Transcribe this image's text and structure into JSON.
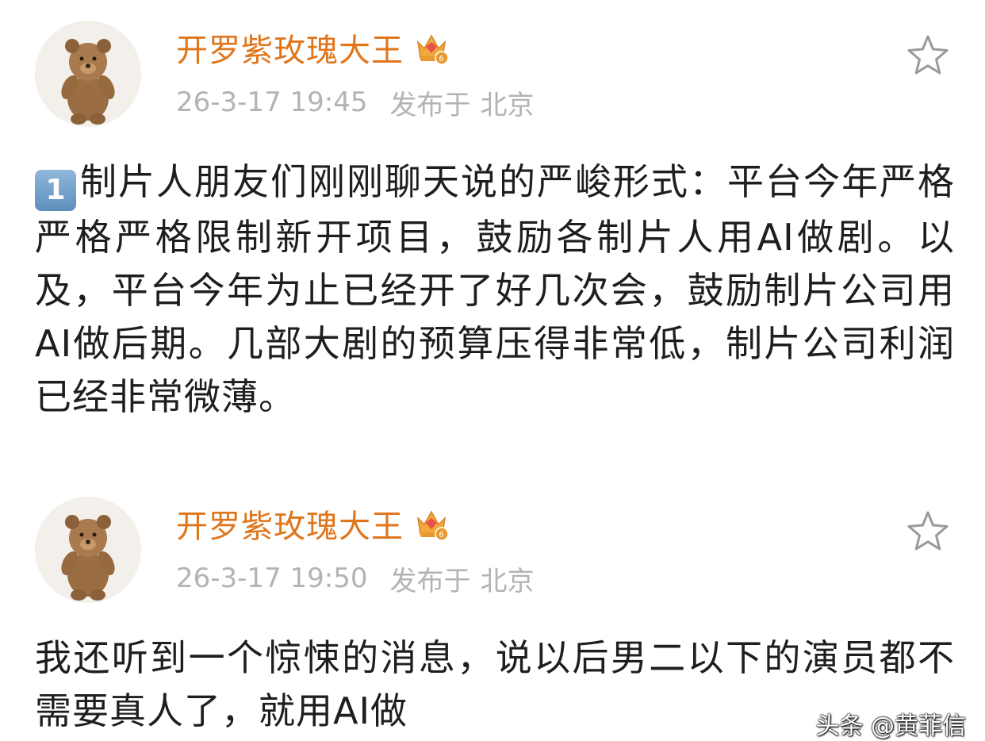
{
  "posts": [
    {
      "username": "开罗紫玫瑰大王",
      "vip_level": "6",
      "time": "26-3-17 19:45",
      "location_label": "发布于",
      "location": "北京",
      "number_badge": "1",
      "content": "制片人朋友们刚刚聊天说的严峻形式：平台今年严格严格严格限制新开项目，鼓励各制片人用AI做剧。以及，平台今年为止已经开了好几次会，鼓励制片公司用AI做后期。几部大剧的预算压得非常低，制片公司利润已经非常微薄。",
      "icons": {
        "avatar": "teddy-bear-avatar",
        "badge": "crown-vip-icon",
        "favorite": "star-icon"
      }
    },
    {
      "username": "开罗紫玫瑰大王",
      "vip_level": "6",
      "time": "26-3-17 19:50",
      "location_label": "发布于",
      "location": "北京",
      "content": "我还听到一个惊悚的消息，说以后男二以下的演员都不需要真人了，就用AI做",
      "icons": {
        "avatar": "teddy-bear-avatar",
        "badge": "crown-vip-icon",
        "favorite": "star-icon"
      }
    }
  ],
  "watermark": "头条 @黄菲信",
  "colors": {
    "username": "#e0761c",
    "meta": "#b3b3b3",
    "text": "#1e1e1e",
    "badge": "#f2a93b"
  }
}
